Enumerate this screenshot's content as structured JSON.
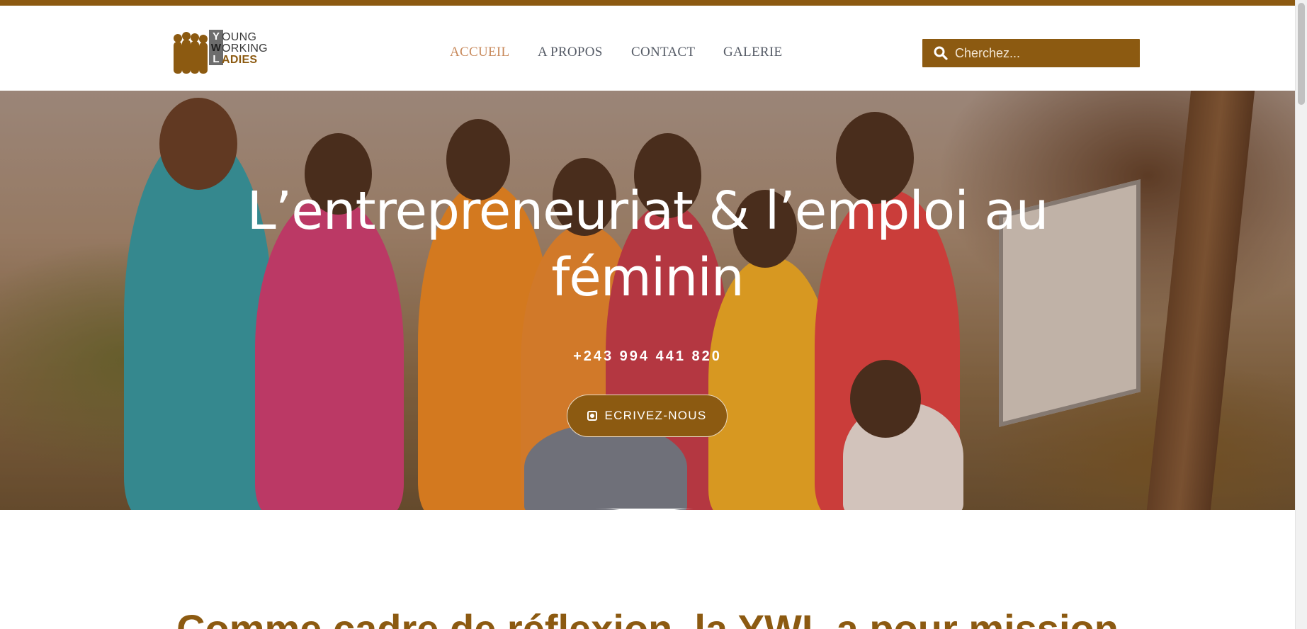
{
  "brand": {
    "logo_lines": [
      "OUNG",
      "ORKING",
      "ADIES"
    ],
    "logo_initials": [
      "Y",
      "W",
      "L"
    ],
    "accent_color": "#8c5a11"
  },
  "nav": {
    "items": [
      {
        "label": "ACCUEIL",
        "active": true
      },
      {
        "label": "A PROPOS",
        "active": false
      },
      {
        "label": "CONTACT",
        "active": false
      },
      {
        "label": "GALERIE",
        "active": false
      }
    ]
  },
  "search": {
    "placeholder": "Cherchez...",
    "icon": "search-icon"
  },
  "hero": {
    "title": "L’entrepreneuriat & l’emploi au féminin",
    "phone": "+243 994 441 820",
    "cta_label": "ECRIVEZ-NOUS",
    "cta_icon": "whatsapp-icon"
  },
  "section": {
    "title": "Comme cadre de réflexion, la YWL a pour mission"
  }
}
